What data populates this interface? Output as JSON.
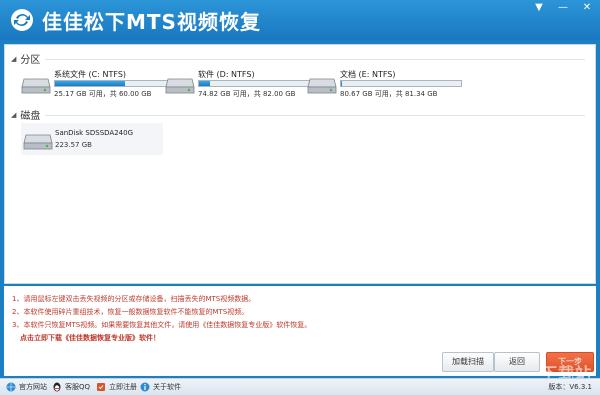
{
  "app": {
    "title": "佳佳松下MTS视频恢复"
  },
  "window_controls": {
    "menu": "▼",
    "minimize": "—",
    "close": "✕"
  },
  "sections": {
    "partitions": "分区",
    "disks": "磁盘"
  },
  "drives": [
    {
      "name": "系统文件 (C: NTFS)",
      "size": "25.17 GB 可用，共 60.00 GB",
      "used_fraction": 0.58
    },
    {
      "name": "软件 (D: NTFS)",
      "size": "74.82 GB 可用，共 82.00 GB",
      "used_fraction": 0.09
    },
    {
      "name": "文档 (E: NTFS)",
      "size": "80.67 GB 可用，共 81.34 GB",
      "used_fraction": 0.01
    }
  ],
  "disk": {
    "name": "SanDisk SDSSDA240G",
    "size": "223.57 GB"
  },
  "notes": [
    "1、请用鼠标左键双击丢失视频的分区或存储设备，扫描丢失的MTS视频数据。",
    "2、本软件使用碎片重组技术，恢复一般数据恢复软件不能恢复的MTS视频。",
    "3、本软件只恢复MTS视频。如果需要恢复其他文件，请使用《佳佳数据恢复专业版》软件恢复。",
    "点击立即下载《佳佳数据恢复专业版》软件！"
  ],
  "buttons": {
    "load_scan": "加载扫描",
    "back": "返回",
    "next": "下一步"
  },
  "watermark": "下载站",
  "statusbar": {
    "website": "官方网站",
    "qq": "客服QQ",
    "register": "立即注册",
    "about": "关于软件",
    "version": "版本：V6.3.1"
  },
  "colors": {
    "title_bar": "#1a78c0",
    "note_text": "#c0392b",
    "next_button": "#e0532a"
  }
}
